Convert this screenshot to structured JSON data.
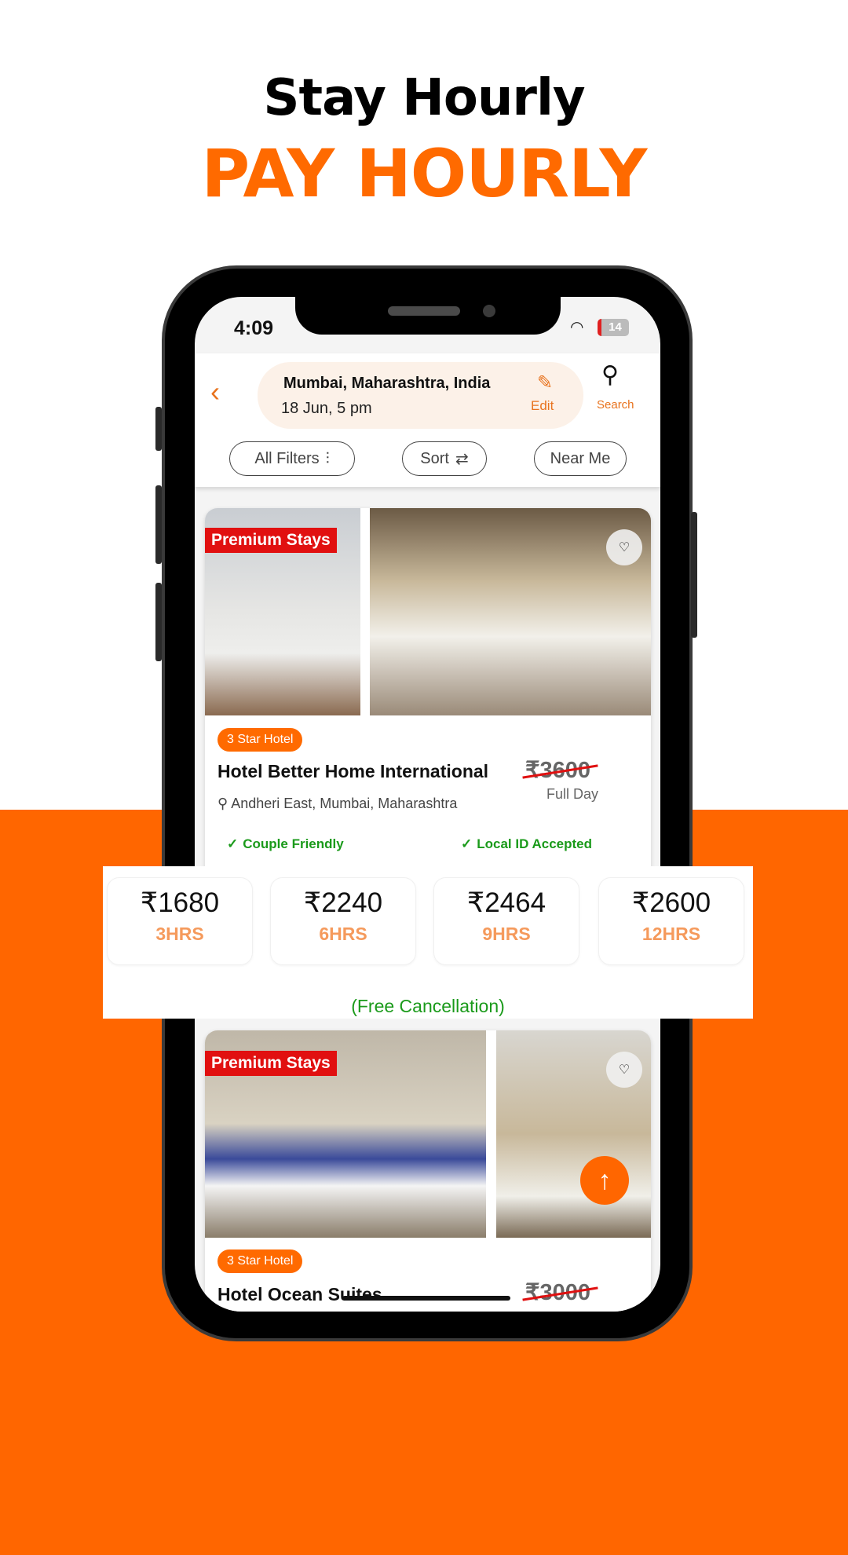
{
  "headline": {
    "line1": "Stay Hourly",
    "line2": "PAY HOURLY"
  },
  "status_bar": {
    "time": "4:09",
    "battery": "14"
  },
  "header": {
    "location": "Mumbai, Maharashtra, India",
    "datetime": "18 Jun, 5 pm",
    "edit_label": "Edit",
    "search_label": "Search"
  },
  "filters": [
    {
      "label": "All Filters"
    },
    {
      "label": "Sort"
    },
    {
      "label": "Near Me"
    }
  ],
  "hotels": [
    {
      "tag": "Premium Stays",
      "badge": "3 Star Hotel",
      "name": "Hotel Better Home International",
      "original_price": "₹3600",
      "price_period": "Full Day",
      "location": "Andheri East, Mumbai, Maharashtra",
      "features": [
        "Couple Friendly",
        "Local ID Accepted"
      ]
    },
    {
      "tag": "Premium Stays",
      "badge": "3 Star Hotel",
      "name": "Hotel Ocean Suites",
      "original_price": "₹3000"
    }
  ],
  "hourly_prices": [
    {
      "price": "₹1680",
      "duration": "3HRS"
    },
    {
      "price": "₹2240",
      "duration": "6HRS"
    },
    {
      "price": "₹2464",
      "duration": "9HRS"
    },
    {
      "price": "₹2600",
      "duration": "12HRS"
    }
  ],
  "cancellation": "(Free Cancellation)",
  "colors": {
    "brand": "#FF6600",
    "green": "#1a9a1a",
    "tag_red": "#E11010"
  }
}
